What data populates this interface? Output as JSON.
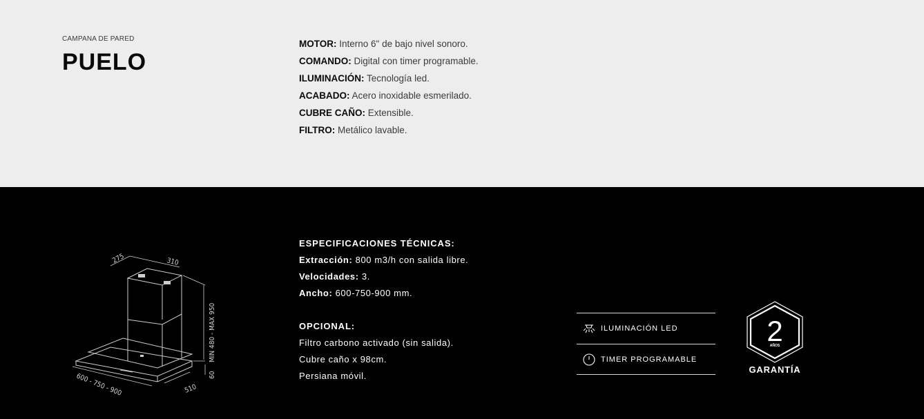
{
  "product": {
    "category": "CAMPANA DE PARED",
    "name": "PUELO"
  },
  "features": [
    {
      "label": "MOTOR:",
      "value": "Interno 6\" de bajo nivel sonoro."
    },
    {
      "label": "COMANDO:",
      "value": "Digital con timer programable."
    },
    {
      "label": "ILUMINACIÓN:",
      "value": "Tecnología led."
    },
    {
      "label": "ACABADO:",
      "value": "Acero inoxidable esmerilado."
    },
    {
      "label": "CUBRE CAÑO:",
      "value": "Extensible."
    },
    {
      "label": "FILTRO:",
      "value": "Metálico lavable."
    }
  ],
  "drawing": {
    "dim_top_depth": "275",
    "dim_top_width": "310",
    "dim_height": "MIN 480 - MAX 950",
    "dim_thickness": "60",
    "dim_width": "600 - 750 - 900",
    "dim_depth": "510"
  },
  "specs": {
    "heading": "ESPECIFICACIONES TÉCNICAS:",
    "rows": [
      {
        "label": "Extracción:",
        "value": "800 m3/h con salida libre."
      },
      {
        "label": "Velocidades:",
        "value": "3."
      },
      {
        "label": "Ancho:",
        "value": "600-750-900 mm."
      }
    ]
  },
  "optional": {
    "heading": "OPCIONAL:",
    "items": [
      "Filtro carbono activado (sin salida).",
      "Cubre caño x 98cm.",
      "Persiana móvil."
    ]
  },
  "badges": [
    {
      "label": "ILUMINACIÓN LED",
      "icon": "led-light-icon"
    },
    {
      "label": "TIMER PROGRAMABLE",
      "icon": "clock-icon"
    }
  ],
  "warranty": {
    "number": "2",
    "unit": "AÑOS",
    "label": "GARANTÍA"
  },
  "colors": {
    "top_background": "#eeeded",
    "bottom_background": "#000000",
    "text_dark": "#0a0a0a",
    "text_light": "#ffffff"
  }
}
